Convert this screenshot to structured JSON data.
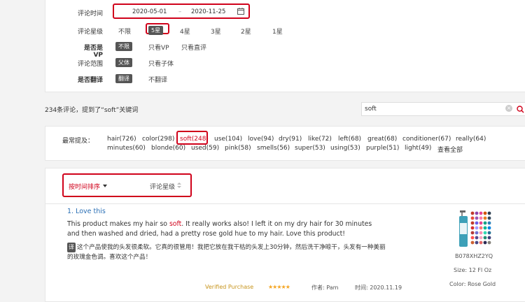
{
  "filters": {
    "date": {
      "label": "评论时间",
      "start": "2020-05-01",
      "sep": "–",
      "end": "2020-11-25"
    },
    "rating": {
      "label": "评论星级",
      "options": [
        "不限",
        "5星",
        "4星",
        "3星",
        "2星",
        "1星"
      ]
    },
    "vp": {
      "label": "是否是VP",
      "options": [
        "不限",
        "只看VP",
        "只看直评"
      ]
    },
    "scope": {
      "label": "评论范围",
      "options": [
        "父体",
        "只看子体"
      ]
    },
    "translate": {
      "label": "是否翻译",
      "options": [
        "翻译",
        "不翻译"
      ]
    }
  },
  "summary": "234条评论，提到了“soft”关键词",
  "search": {
    "value": "soft"
  },
  "keywords": {
    "label": "最常提及：",
    "row1": [
      "hair(726)",
      "color(298)",
      "soft(248)",
      "use(104)",
      "love(94)",
      "dry(91)",
      "like(72)",
      "left(68)",
      "great(68)",
      "conditioner(67)",
      "really(64)"
    ],
    "row2": [
      "minutes(60)",
      "blonde(60)",
      "used(59)",
      "pink(58)",
      "smells(56)",
      "super(53)",
      "using(53)",
      "purple(51)",
      "light(49)",
      "查看全部"
    ]
  },
  "sort": {
    "by_time": "按时间排序",
    "by_rating": "评论星级"
  },
  "review": {
    "title": "1. Love this",
    "en_before": "This product makes my hair so ",
    "en_highlight": "soft",
    "en_after": ". It really works also! I left it on my dry hair for 30 minutes and then washed and dried, had a pretty rose gold hue to my hair. Love this product!",
    "zh_badge": "译",
    "zh": "这个产品使我的头发很柔软。它真的很管用！我把它放在我干枯的头发上30分钟，然后洗干净晾干，头发有一种美丽的玫瑰金色调。喜欢这个产品！",
    "verified": "Verified Purchase",
    "stars": "★★★★★",
    "author": "作者: Pam",
    "time": "时间: 2020.11.19",
    "asin": "B078XHZ2YQ",
    "size": "Size:  12 Fl Oz",
    "color": "Color:  Rose Gold"
  },
  "colors": {
    "accent_red": "#d0021b",
    "link_blue": "#2a6fb5",
    "pill_gray": "#555555"
  }
}
